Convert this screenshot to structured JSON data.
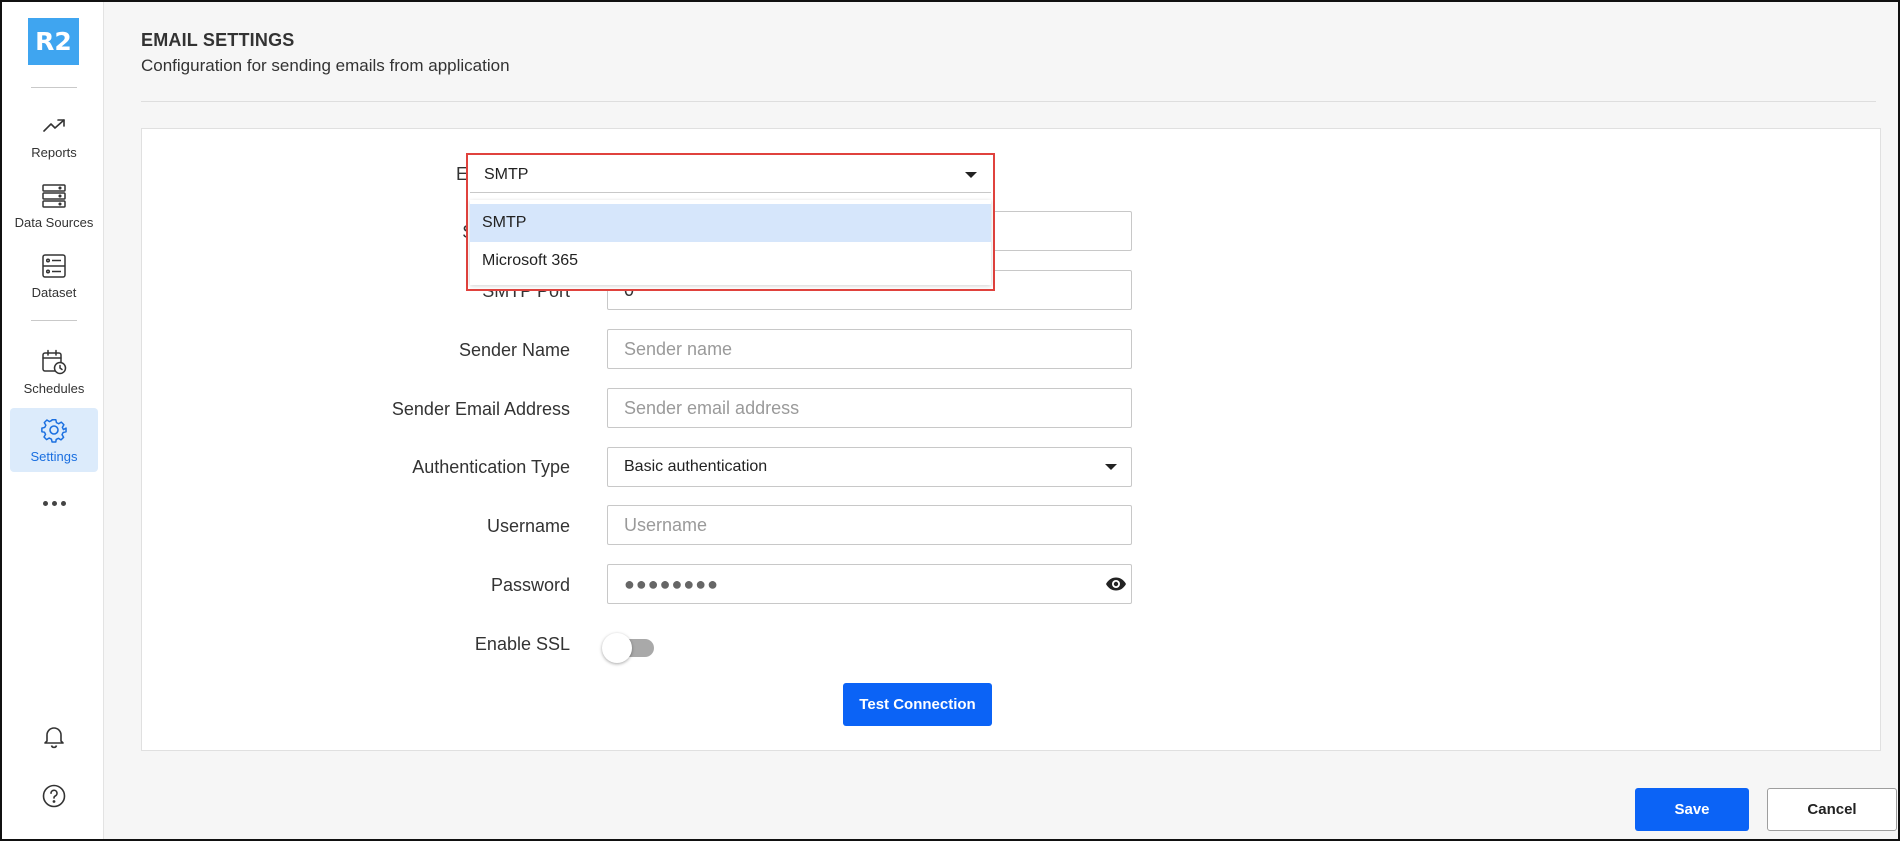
{
  "app": {
    "logo_text": "R2"
  },
  "sidebar": {
    "items": [
      {
        "label": "Reports",
        "icon": "trending-up-icon"
      },
      {
        "label": "Data Sources",
        "icon": "server-icon"
      },
      {
        "label": "Dataset",
        "icon": "dataset-icon"
      },
      {
        "label": "Schedules",
        "icon": "calendar-clock-icon"
      },
      {
        "label": "Settings",
        "icon": "gear-icon",
        "active": true
      }
    ],
    "more_icon": "more-horizontal-icon",
    "bottom_icons": [
      "bell-icon",
      "help-icon"
    ]
  },
  "header": {
    "title": "EMAIL SETTINGS",
    "subtitle": "Configuration for sending emails from application"
  },
  "form": {
    "email_account": {
      "label": "Email Account",
      "value": "SMTP",
      "options": [
        "SMTP",
        "Microsoft 365"
      ],
      "open": true
    },
    "smtp_server": {
      "label": "SMTP Server"
    },
    "smtp_port": {
      "label": "SMTP Port",
      "value": "0"
    },
    "sender_name": {
      "label": "Sender Name",
      "placeholder": "Sender name"
    },
    "sender_email": {
      "label": "Sender Email Address",
      "placeholder": "Sender email address"
    },
    "auth_type": {
      "label": "Authentication Type",
      "value": "Basic authentication"
    },
    "username": {
      "label": "Username",
      "placeholder": "Username"
    },
    "password": {
      "label": "Password",
      "value": "●●●●●●●●"
    },
    "enable_ssl": {
      "label": "Enable SSL",
      "on": false
    },
    "test_connection_label": "Test Connection"
  },
  "footer": {
    "save_label": "Save",
    "cancel_label": "Cancel"
  },
  "colors": {
    "accent": "#0b63f6",
    "logo_bg": "#3fa5f0",
    "active_nav_bg": "#dcebfb",
    "highlight_border": "#e0423d"
  }
}
